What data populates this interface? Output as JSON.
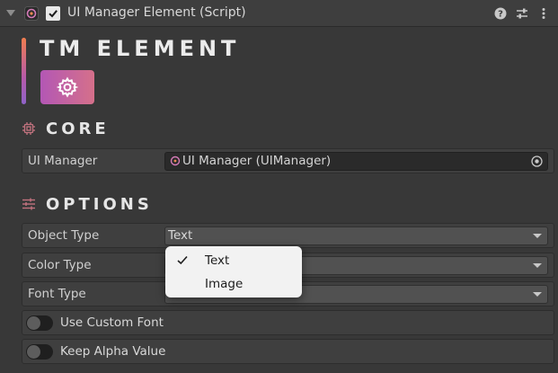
{
  "header": {
    "title": "UI Manager Element (Script)",
    "icons": [
      "foldout-arrow",
      "script-icon",
      "enable-checkbox",
      "help-icon",
      "presets-icon",
      "menu-icon"
    ]
  },
  "banner": {
    "title": "TM ELEMENT",
    "button_icon": "gear-icon"
  },
  "core": {
    "title": "CORE",
    "icon": "chip-icon",
    "ui_manager_label": "UI Manager",
    "ui_manager_value": "UI Manager (UIManager)"
  },
  "options": {
    "title": "OPTIONS",
    "icon": "sliders-icon",
    "object_type_label": "Object Type",
    "object_type_value": "Text",
    "color_type_label": "Color Type",
    "font_type_label": "Font Type",
    "use_custom_font_label": "Use Custom Font",
    "keep_alpha_label": "Keep Alpha Value",
    "use_custom_font_on": false,
    "keep_alpha_on": false
  },
  "popup": {
    "items": [
      {
        "label": "Text",
        "checked": true
      },
      {
        "label": "Image",
        "checked": false
      }
    ]
  },
  "colors": {
    "background": "#383838",
    "accent_orange": "#f07e4f",
    "accent_purple": "#b357b5",
    "section_icon": "#c3737f"
  }
}
